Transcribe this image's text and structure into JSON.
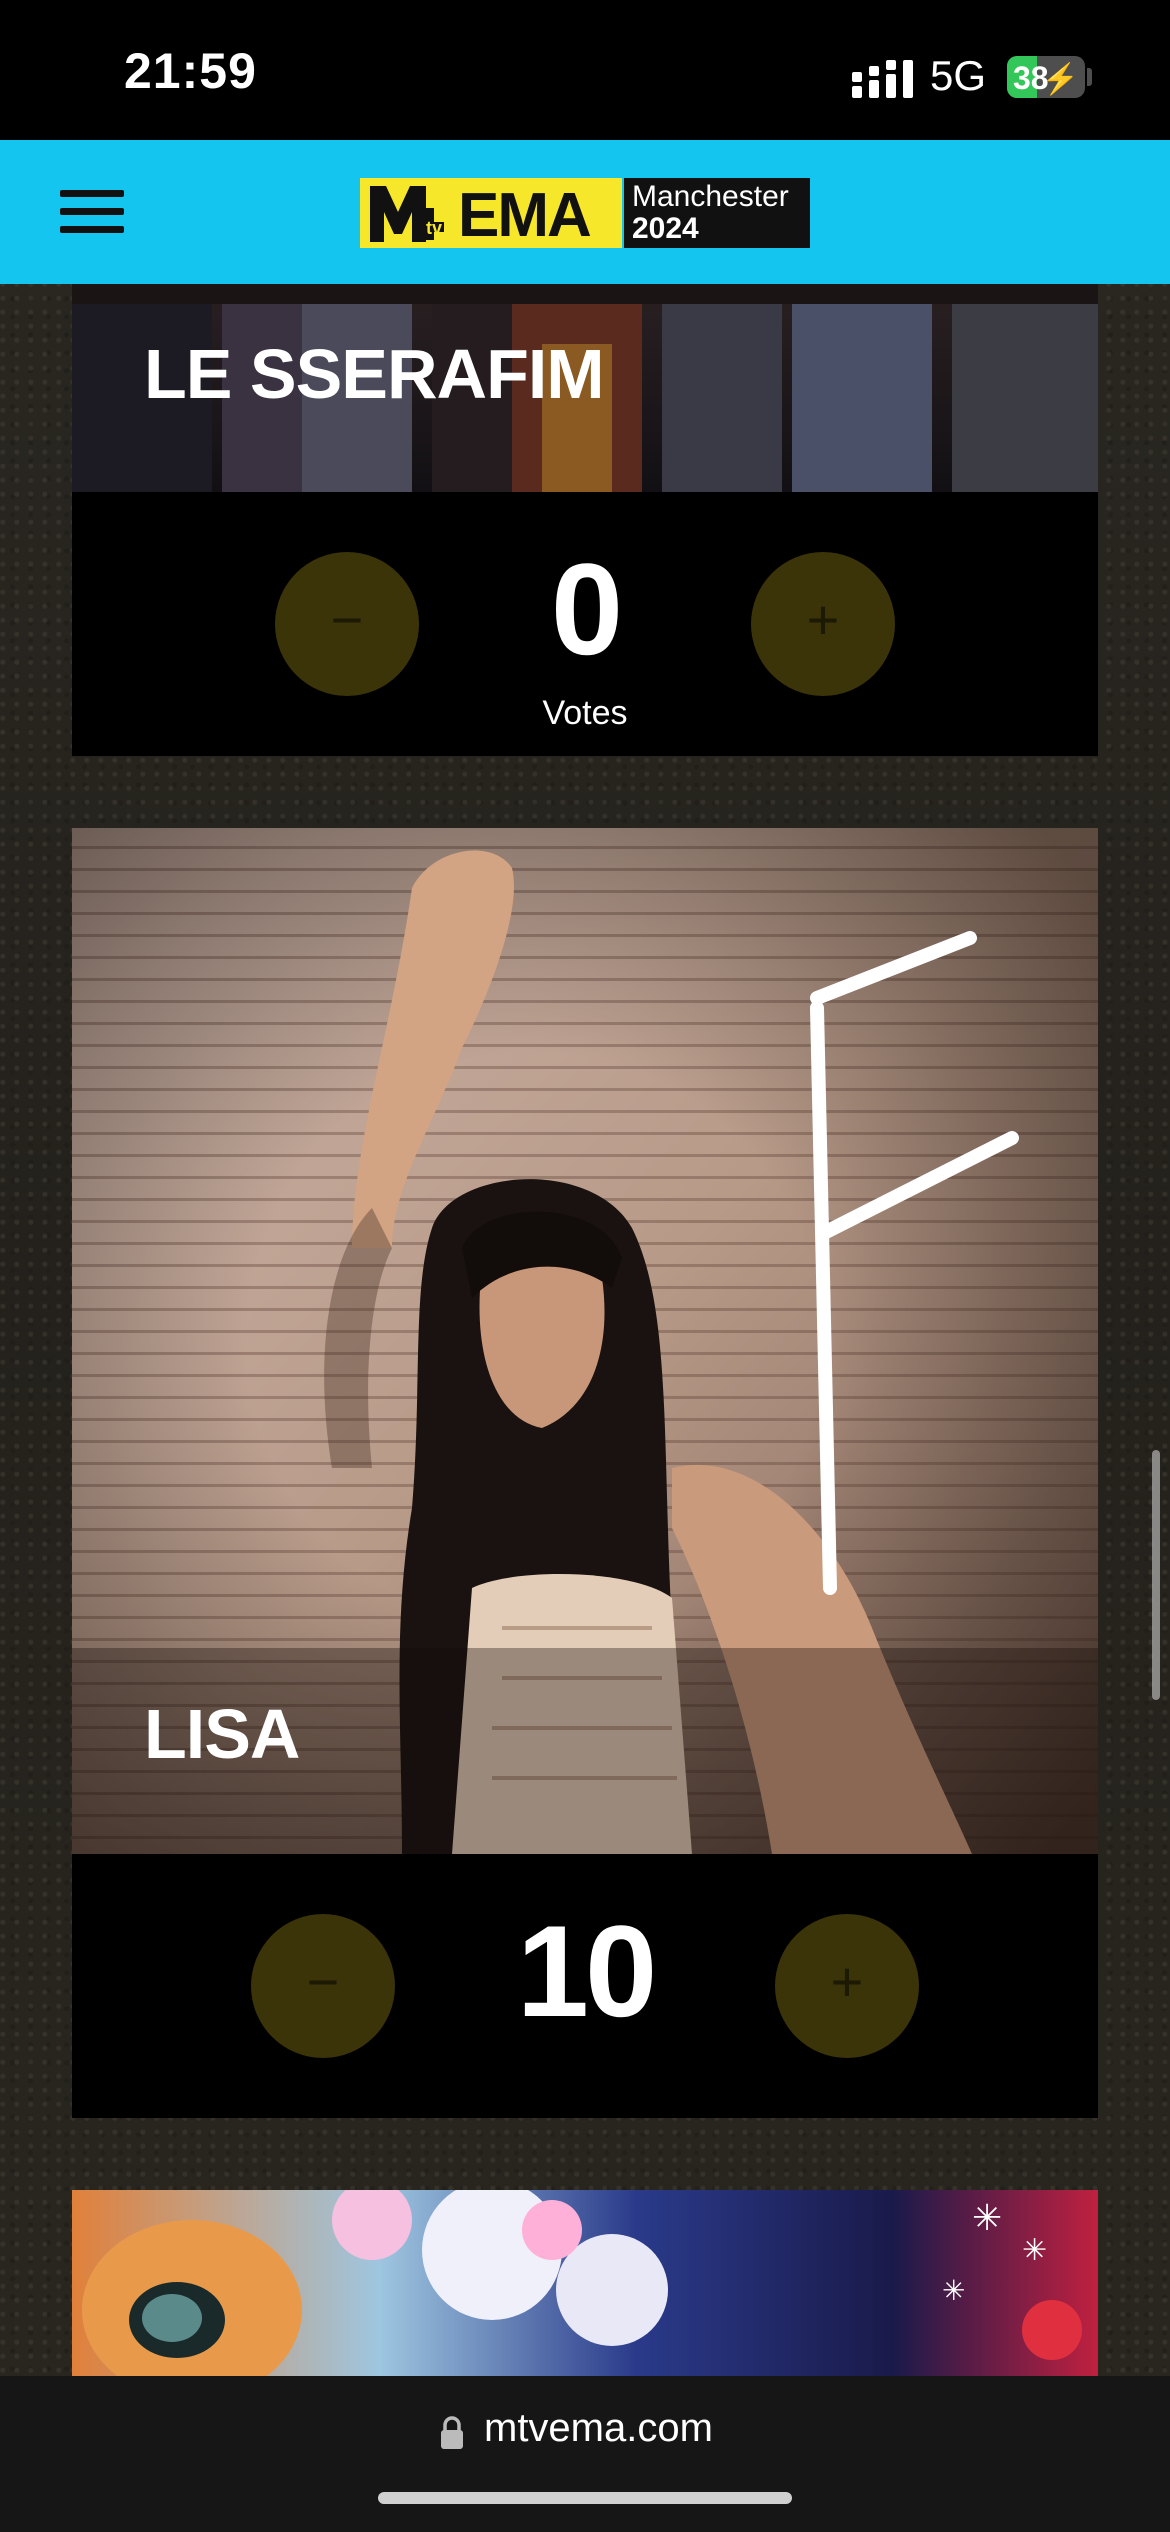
{
  "status_bar": {
    "time": "21:59",
    "network": "5G",
    "battery_level": "38",
    "battery_color": "#33c659"
  },
  "header": {
    "menu_icon": "hamburger-menu-icon",
    "logo_text": "EMA",
    "logo_city": "Manchester",
    "logo_year": "2024",
    "background": "#13c5ef",
    "accent": "#f7e72a"
  },
  "nominees": [
    {
      "name": "LE SSERAFIM",
      "votes": "0",
      "votes_label": "Votes",
      "minus_icon": "minus-icon",
      "plus_icon": "plus-icon"
    },
    {
      "name": "LISA",
      "votes": "10",
      "votes_label": "",
      "minus_icon": "minus-icon",
      "plus_icon": "plus-icon"
    }
  ],
  "browser": {
    "url": "mtvema.com",
    "lock_icon": "lock-icon"
  }
}
